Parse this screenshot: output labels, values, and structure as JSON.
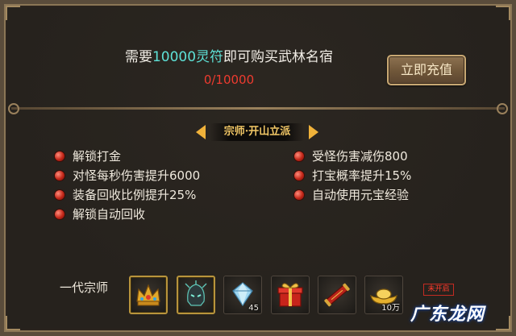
{
  "purchase": {
    "text_prefix": "需要",
    "amount_highlight": "10000灵符",
    "text_suffix": "即可购买武林名宿",
    "progress": "0/10000",
    "recharge_button": "立即充值"
  },
  "tier": {
    "title": "宗师·开山立派"
  },
  "benefits": {
    "left": [
      "解锁打金",
      "对怪每秒伤害提升6000",
      "装备回收比例提升25%",
      "解锁自动回收"
    ],
    "right": [
      "受怪伤害减伤800",
      "打宝概率提升15%",
      "自动使用元宝经验"
    ]
  },
  "rewards": {
    "label": "一代宗师",
    "items": [
      {
        "icon": "golden-crown-icon",
        "count": ""
      },
      {
        "icon": "dark-helmet-icon",
        "count": ""
      },
      {
        "icon": "diamond-gem-icon",
        "count": "45"
      },
      {
        "icon": "gift-box-icon",
        "count": ""
      },
      {
        "icon": "scroll-icon",
        "count": ""
      },
      {
        "icon": "gold-ingot-icon",
        "count": "10万"
      }
    ],
    "status_badge": "未开启"
  },
  "watermark": "广东龙网",
  "colors": {
    "accent_cyan": "#5ee1d7",
    "progress_red": "#ee3b2f",
    "title_gold": "#f2c766",
    "badge_red": "#ff3b2c"
  }
}
